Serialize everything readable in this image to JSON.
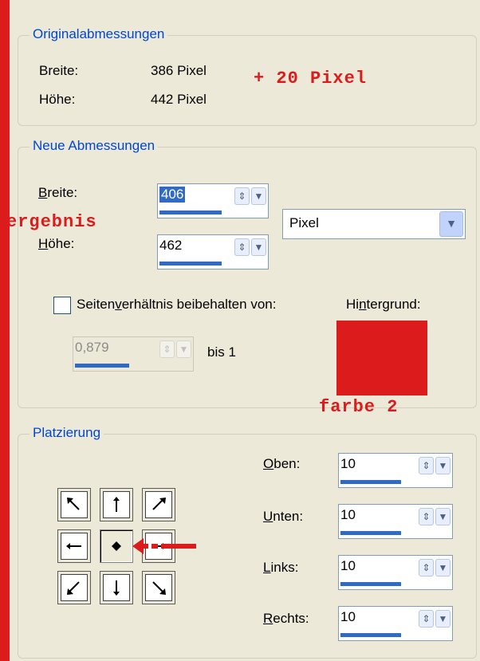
{
  "orig": {
    "legend": "Originalabmessungen",
    "width_label": "Breite:",
    "width_value": "386 Pixel",
    "height_label": "Höhe:",
    "height_value": "442 Pixel"
  },
  "annotation_plus": "+ 20 Pixel",
  "new": {
    "legend": "Neue Abmessungen",
    "width_label_u": "B",
    "width_label_rest": "reite:",
    "width_value": "406",
    "height_label_u": "H",
    "height_label_rest": "öhe:",
    "height_value": "462",
    "unit_value": "Pixel",
    "aspect_label_a": "Seiten",
    "aspect_label_u": "v",
    "aspect_label_b": "erhältnis beibehalten von:",
    "aspect_value": "0,879",
    "aspect_to": "bis 1",
    "bg_label_a": "Hi",
    "bg_label_u": "n",
    "bg_label_b": "tergrund:",
    "bg_color": "#dc1c1c"
  },
  "annotation_result": "ergebnis",
  "annotation_color": "farbe 2",
  "placement": {
    "legend": "Platzierung",
    "fields": [
      {
        "label_u": "O",
        "label_rest": "ben:",
        "value": "10"
      },
      {
        "label_u": "U",
        "label_rest": "nten:",
        "value": "10"
      },
      {
        "label_u": "L",
        "label_rest": "inks:",
        "value": "10"
      },
      {
        "label_u": "R",
        "label_rest": "echts:",
        "value": "10"
      }
    ],
    "anchor_selected": "center"
  }
}
